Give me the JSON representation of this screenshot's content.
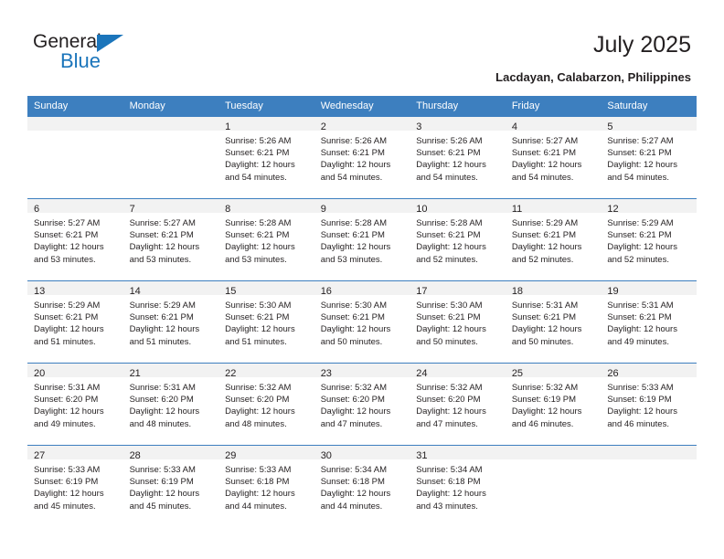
{
  "brand": {
    "name_top": "General",
    "name_bottom": "Blue",
    "triangle_icon": "triangle-icon",
    "accent_color": "#1b75bb"
  },
  "header": {
    "title": "July 2025",
    "subtitle": "Lacdayan, Calabarzon, Philippines"
  },
  "calendar": {
    "header_color": "#3d7fbf",
    "daynum_strip_color": "#f2f2f2",
    "weekdays": [
      "Sunday",
      "Monday",
      "Tuesday",
      "Wednesday",
      "Thursday",
      "Friday",
      "Saturday"
    ],
    "weeks": [
      [
        {
          "day": "",
          "lines": []
        },
        {
          "day": "",
          "lines": []
        },
        {
          "day": "1",
          "lines": [
            "Sunrise: 5:26 AM",
            "Sunset: 6:21 PM",
            "Daylight: 12 hours",
            "and 54 minutes."
          ]
        },
        {
          "day": "2",
          "lines": [
            "Sunrise: 5:26 AM",
            "Sunset: 6:21 PM",
            "Daylight: 12 hours",
            "and 54 minutes."
          ]
        },
        {
          "day": "3",
          "lines": [
            "Sunrise: 5:26 AM",
            "Sunset: 6:21 PM",
            "Daylight: 12 hours",
            "and 54 minutes."
          ]
        },
        {
          "day": "4",
          "lines": [
            "Sunrise: 5:27 AM",
            "Sunset: 6:21 PM",
            "Daylight: 12 hours",
            "and 54 minutes."
          ]
        },
        {
          "day": "5",
          "lines": [
            "Sunrise: 5:27 AM",
            "Sunset: 6:21 PM",
            "Daylight: 12 hours",
            "and 54 minutes."
          ]
        }
      ],
      [
        {
          "day": "6",
          "lines": [
            "Sunrise: 5:27 AM",
            "Sunset: 6:21 PM",
            "Daylight: 12 hours",
            "and 53 minutes."
          ]
        },
        {
          "day": "7",
          "lines": [
            "Sunrise: 5:27 AM",
            "Sunset: 6:21 PM",
            "Daylight: 12 hours",
            "and 53 minutes."
          ]
        },
        {
          "day": "8",
          "lines": [
            "Sunrise: 5:28 AM",
            "Sunset: 6:21 PM",
            "Daylight: 12 hours",
            "and 53 minutes."
          ]
        },
        {
          "day": "9",
          "lines": [
            "Sunrise: 5:28 AM",
            "Sunset: 6:21 PM",
            "Daylight: 12 hours",
            "and 53 minutes."
          ]
        },
        {
          "day": "10",
          "lines": [
            "Sunrise: 5:28 AM",
            "Sunset: 6:21 PM",
            "Daylight: 12 hours",
            "and 52 minutes."
          ]
        },
        {
          "day": "11",
          "lines": [
            "Sunrise: 5:29 AM",
            "Sunset: 6:21 PM",
            "Daylight: 12 hours",
            "and 52 minutes."
          ]
        },
        {
          "day": "12",
          "lines": [
            "Sunrise: 5:29 AM",
            "Sunset: 6:21 PM",
            "Daylight: 12 hours",
            "and 52 minutes."
          ]
        }
      ],
      [
        {
          "day": "13",
          "lines": [
            "Sunrise: 5:29 AM",
            "Sunset: 6:21 PM",
            "Daylight: 12 hours",
            "and 51 minutes."
          ]
        },
        {
          "day": "14",
          "lines": [
            "Sunrise: 5:29 AM",
            "Sunset: 6:21 PM",
            "Daylight: 12 hours",
            "and 51 minutes."
          ]
        },
        {
          "day": "15",
          "lines": [
            "Sunrise: 5:30 AM",
            "Sunset: 6:21 PM",
            "Daylight: 12 hours",
            "and 51 minutes."
          ]
        },
        {
          "day": "16",
          "lines": [
            "Sunrise: 5:30 AM",
            "Sunset: 6:21 PM",
            "Daylight: 12 hours",
            "and 50 minutes."
          ]
        },
        {
          "day": "17",
          "lines": [
            "Sunrise: 5:30 AM",
            "Sunset: 6:21 PM",
            "Daylight: 12 hours",
            "and 50 minutes."
          ]
        },
        {
          "day": "18",
          "lines": [
            "Sunrise: 5:31 AM",
            "Sunset: 6:21 PM",
            "Daylight: 12 hours",
            "and 50 minutes."
          ]
        },
        {
          "day": "19",
          "lines": [
            "Sunrise: 5:31 AM",
            "Sunset: 6:21 PM",
            "Daylight: 12 hours",
            "and 49 minutes."
          ]
        }
      ],
      [
        {
          "day": "20",
          "lines": [
            "Sunrise: 5:31 AM",
            "Sunset: 6:20 PM",
            "Daylight: 12 hours",
            "and 49 minutes."
          ]
        },
        {
          "day": "21",
          "lines": [
            "Sunrise: 5:31 AM",
            "Sunset: 6:20 PM",
            "Daylight: 12 hours",
            "and 48 minutes."
          ]
        },
        {
          "day": "22",
          "lines": [
            "Sunrise: 5:32 AM",
            "Sunset: 6:20 PM",
            "Daylight: 12 hours",
            "and 48 minutes."
          ]
        },
        {
          "day": "23",
          "lines": [
            "Sunrise: 5:32 AM",
            "Sunset: 6:20 PM",
            "Daylight: 12 hours",
            "and 47 minutes."
          ]
        },
        {
          "day": "24",
          "lines": [
            "Sunrise: 5:32 AM",
            "Sunset: 6:20 PM",
            "Daylight: 12 hours",
            "and 47 minutes."
          ]
        },
        {
          "day": "25",
          "lines": [
            "Sunrise: 5:32 AM",
            "Sunset: 6:19 PM",
            "Daylight: 12 hours",
            "and 46 minutes."
          ]
        },
        {
          "day": "26",
          "lines": [
            "Sunrise: 5:33 AM",
            "Sunset: 6:19 PM",
            "Daylight: 12 hours",
            "and 46 minutes."
          ]
        }
      ],
      [
        {
          "day": "27",
          "lines": [
            "Sunrise: 5:33 AM",
            "Sunset: 6:19 PM",
            "Daylight: 12 hours",
            "and 45 minutes."
          ]
        },
        {
          "day": "28",
          "lines": [
            "Sunrise: 5:33 AM",
            "Sunset: 6:19 PM",
            "Daylight: 12 hours",
            "and 45 minutes."
          ]
        },
        {
          "day": "29",
          "lines": [
            "Sunrise: 5:33 AM",
            "Sunset: 6:18 PM",
            "Daylight: 12 hours",
            "and 44 minutes."
          ]
        },
        {
          "day": "30",
          "lines": [
            "Sunrise: 5:34 AM",
            "Sunset: 6:18 PM",
            "Daylight: 12 hours",
            "and 44 minutes."
          ]
        },
        {
          "day": "31",
          "lines": [
            "Sunrise: 5:34 AM",
            "Sunset: 6:18 PM",
            "Daylight: 12 hours",
            "and 43 minutes."
          ]
        },
        {
          "day": "",
          "lines": []
        },
        {
          "day": "",
          "lines": []
        }
      ]
    ]
  }
}
